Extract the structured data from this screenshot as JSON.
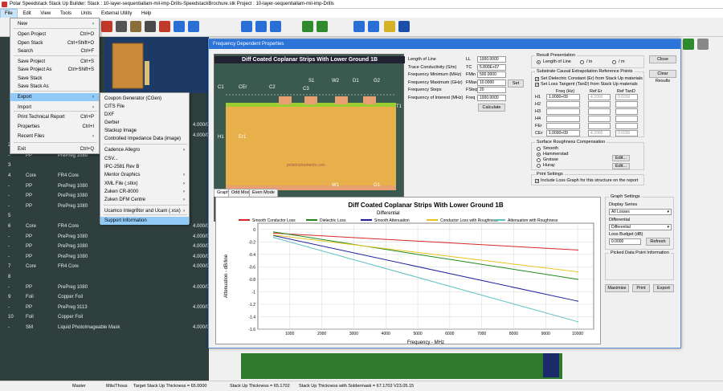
{
  "window": {
    "title": "Polar Speedstack Stack Up Builder:  Stack : 10-layer-sequentiallam-mil-imp-Drills-SpeedstackBrochure.stk    Project : 10-layer-sequentiallam-mil-imp-Drills"
  },
  "menubar": [
    "File",
    "Edit",
    "View",
    "Tools",
    "Units",
    "External Utility",
    "Help"
  ],
  "file_menu": [
    {
      "label": "New",
      "shortcut": "",
      "arrow": "›"
    },
    {
      "label": "Open Project",
      "shortcut": "Ctrl+O"
    },
    {
      "label": "Open Stack",
      "shortcut": "Ctrl+Shift+O"
    },
    {
      "label": "Search",
      "shortcut": "Ctrl+F"
    },
    {
      "label": "Save Project",
      "shortcut": "Ctrl+S"
    },
    {
      "label": "Save Project As",
      "shortcut": "Ctrl+Shift+S"
    },
    {
      "label": "Save Stack",
      "shortcut": ""
    },
    {
      "label": "Save Stack As",
      "shortcut": ""
    },
    {
      "label": "Export",
      "shortcut": "",
      "arrow": "›"
    },
    {
      "label": "Import",
      "shortcut": "",
      "arrow": "›"
    },
    {
      "label": "Print Technical Report",
      "shortcut": "Ctrl+P"
    },
    {
      "label": "Properties",
      "shortcut": "Ctrl+I"
    },
    {
      "label": "Recent Files",
      "shortcut": "",
      "arrow": "›"
    },
    {
      "label": "Exit",
      "shortcut": "Ctrl+Q"
    }
  ],
  "export_menu": [
    {
      "label": "Coupon Generator (CGen)"
    },
    {
      "label": "CITS File"
    },
    {
      "label": "DXF"
    },
    {
      "label": "Gerber"
    },
    {
      "label": "Stackup Image"
    },
    {
      "label": "Controlled Impedance Data (image)"
    },
    {
      "label": "Cadence Allegro",
      "arrow": "›"
    },
    {
      "label": "CSV..."
    },
    {
      "label": "IPC-2581 Rev B"
    },
    {
      "label": "Mentor Graphics",
      "arrow": "›"
    },
    {
      "label": "XML File (.stkx)",
      "arrow": "›"
    },
    {
      "label": "Zuken CR-8000",
      "arrow": "›"
    },
    {
      "label": "Zuken DFM Centre",
      "arrow": "›"
    },
    {
      "label": "Ucamco Integr8tor and Ucam (.xsx)",
      "arrow": "›"
    },
    {
      "label": "Support Information"
    }
  ],
  "stack_rows": [
    {
      "num": "",
      "type": "",
      "mat": "",
      "thk": "4.000/0"
    },
    {
      "num": "",
      "type": "",
      "mat": "",
      "thk": "4.000/0"
    },
    {
      "num": "2",
      "type": "Foil",
      "mat": "Copper Foil",
      "thk": ""
    },
    {
      "num": "-",
      "type": "PP",
      "mat": "PrePreg 1080",
      "thk": ""
    },
    {
      "num": "3",
      "type": "",
      "mat": "",
      "thk": ""
    },
    {
      "num": "4",
      "type": "Core",
      "mat": "FR4 Core",
      "thk": ""
    },
    {
      "num": "-",
      "type": "PP",
      "mat": "PrePreg 1080",
      "thk": ""
    },
    {
      "num": "-",
      "type": "PP",
      "mat": "PrePreg 1080",
      "thk": ""
    },
    {
      "num": "-",
      "type": "PP",
      "mat": "PrePreg 1080",
      "thk": ""
    },
    {
      "num": "5",
      "type": "",
      "mat": "",
      "thk": ""
    },
    {
      "num": "6",
      "type": "Core",
      "mat": "FR4 Core",
      "thk": "4.000/0"
    },
    {
      "num": "-",
      "type": "PP",
      "mat": "PrePreg 1080",
      "thk": "4.000/0"
    },
    {
      "num": "-",
      "type": "PP",
      "mat": "PrePreg 1080",
      "thk": "4.000/0"
    },
    {
      "num": "-",
      "type": "PP",
      "mat": "PrePreg 1080",
      "thk": "4.000/0"
    },
    {
      "num": "7",
      "type": "Core",
      "mat": "FR4 Core",
      "thk": "4.000/0"
    },
    {
      "num": "8",
      "type": "",
      "mat": "",
      "thk": ""
    },
    {
      "num": "-",
      "type": "PP",
      "mat": "PrePreg 1080",
      "thk": "4.000/0"
    },
    {
      "num": "9",
      "type": "Foil",
      "mat": "Copper Foil",
      "thk": ""
    },
    {
      "num": "-",
      "type": "PP",
      "mat": "PrePreg 3113",
      "thk": "4.000/0"
    },
    {
      "num": "10",
      "type": "Foil",
      "mat": "Copper Foil",
      "thk": ""
    },
    {
      "num": "-",
      "type": "SM",
      "mat": "Liquid PhotoImageable Mask",
      "thk": "4.000/0.0200"
    }
  ],
  "dialog": {
    "title": "Frequency Dependent Properties",
    "diagram_title": "Diff Coated Coplanar Strips With Lower Ground 1B",
    "diagram_labels": {
      "c1": "C1",
      "cer": "CEr",
      "c2": "C2",
      "s1": "S1",
      "c3": "C3",
      "w2": "W2",
      "d1": "D1",
      "g2": "G2",
      "t1": "T1",
      "h1": "H1",
      "er1": "Er1",
      "w1": "W1",
      "g1": "G1",
      "watermark": "polarinstruments.com"
    },
    "params": [
      {
        "label": "Length of Line",
        "sym": "LL",
        "value": "1000.0000"
      },
      {
        "label": "Trace Conductivity (S/m)",
        "sym": "TC",
        "value": "5.800E+07"
      },
      {
        "label": "Frequency Minimum (MHz)",
        "sym": "FMin",
        "value": "500.0000"
      },
      {
        "label": "Frequency Maximum (GHz)",
        "sym": "FMax",
        "value": "10.0000"
      },
      {
        "label": "Frequency Steps",
        "sym": "FStep",
        "value": "20"
      },
      {
        "label": "Frequency of Interest (MHz)",
        "sym": "Freq",
        "value": "1000.0000"
      }
    ],
    "set_button": "Set",
    "calculate_button": "Calculate",
    "result_presentation": {
      "title": "Result Presentation",
      "options": [
        "Length of Line",
        "/ in",
        "/ m"
      ],
      "selected": 0
    },
    "close_button": "Close",
    "clear_results_button": "Clear Results",
    "substrate": {
      "title": "Substrate Causal Extrapolation Reference Points",
      "chk1": "Set Dielectric Constant (Er) from Stack Up materials",
      "chk2": "Set Loss Tangent (TanD) from Stack Up materials",
      "headers": [
        "Freq (Hz)",
        "Ref Er",
        "Ref TanD"
      ],
      "rows": [
        {
          "name": "H1",
          "freq": "1.0000+09",
          "er": "4.2000",
          "tand": "0.0200"
        },
        {
          "name": "H2",
          "freq": "",
          "er": "",
          "tand": ""
        },
        {
          "name": "H3",
          "freq": "",
          "er": "",
          "tand": ""
        },
        {
          "name": "H4",
          "freq": "",
          "er": "",
          "tand": ""
        },
        {
          "name": "FEr",
          "freq": "",
          "er": "",
          "tand": ""
        },
        {
          "name": "CEr",
          "freq": "1.0000+09",
          "er": "4.2000",
          "tand": "0.0200"
        }
      ]
    },
    "roughness": {
      "title": "Surface Roughness Compensation",
      "options": [
        "Smooth",
        "Hammerstad",
        "Groisse",
        "Huray"
      ],
      "selected": 1,
      "edit1": "Edit...",
      "edit2": "Edit..."
    },
    "print_settings": {
      "title": "Print Settings",
      "chk": "Include Loss Graph for this structure on the report"
    },
    "tabs": [
      "Graph",
      "Odd Mode",
      "Even Mode"
    ],
    "graph_settings": {
      "title": "Graph Settings",
      "display_series_label": "Display Series",
      "display_series": "All Losses",
      "differential_label": "Differential",
      "differential": "Differential",
      "loss_budget_label": "Loss Budget (dB)",
      "loss_budget": "0.0000",
      "refresh_button": "Refresh"
    },
    "picked_title": "Picked Data Point Information",
    "maximise_button": "Maximise",
    "print_button": "Print",
    "export_button": "Export"
  },
  "chart_data": {
    "type": "line",
    "title": "Diff Coated Coplanar Strips With Lower Ground 1B",
    "subtitle": "Differential",
    "xlabel": "Frequency - MHz",
    "ylabel": "Attenuation - dB/line",
    "xlim": [
      0,
      10500
    ],
    "ylim": [
      -1.6,
      0.1
    ],
    "xticks": [
      1000,
      2000,
      3000,
      4000,
      5000,
      6000,
      7000,
      8000,
      9000,
      10000
    ],
    "yticks": [
      0,
      -0.2,
      -0.4,
      -0.6,
      -0.8,
      -1,
      -1.2,
      -1.4,
      -1.6
    ],
    "ytick_labels": [
      "0",
      "-0.2",
      "-0.4",
      "-0.6",
      "-0.8",
      "-1",
      "-1.2",
      "-1.4",
      "-1.6"
    ],
    "grid": true,
    "legend_position": "top",
    "series": [
      {
        "name": "Smooth Conductor Loss",
        "color": "#d62728",
        "x": [
          500,
          10000
        ],
        "y": [
          -0.06,
          -0.33
        ]
      },
      {
        "name": "Dielectric Loss",
        "color": "#1e8a1e",
        "x": [
          500,
          10000
        ],
        "y": [
          -0.04,
          -0.8
        ]
      },
      {
        "name": "Smooth Attenuation",
        "color": "#1f1f9e",
        "x": [
          500,
          10000
        ],
        "y": [
          -0.1,
          -1.15
        ]
      },
      {
        "name": "Conductor Loss with Roughness",
        "color": "#e6c31e",
        "x": [
          500,
          10000
        ],
        "y": [
          -0.09,
          -0.68
        ]
      },
      {
        "name": "Attenuation with Roughness",
        "color": "#5fc0c0",
        "x": [
          500,
          10000
        ],
        "y": [
          -0.13,
          -1.48
        ]
      }
    ]
  },
  "status": {
    "mode": "Master",
    "units": "Mils/Thous",
    "target": "Target Stack Up Thickness = 65.0000",
    "stackup": "Stack Up Thickness = 65.1702",
    "withmask": "Stack Up Thickness with Soldermask = 67.1702",
    "version": "V23.05.15"
  }
}
